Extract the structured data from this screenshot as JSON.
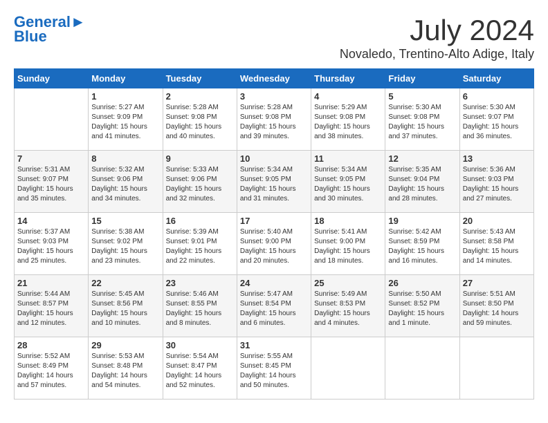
{
  "header": {
    "logo_line1": "General",
    "logo_line2": "Blue",
    "month": "July 2024",
    "location": "Novaledo, Trentino-Alto Adige, Italy"
  },
  "weekdays": [
    "Sunday",
    "Monday",
    "Tuesday",
    "Wednesday",
    "Thursday",
    "Friday",
    "Saturday"
  ],
  "weeks": [
    [
      {
        "day": "",
        "info": ""
      },
      {
        "day": "1",
        "info": "Sunrise: 5:27 AM\nSunset: 9:09 PM\nDaylight: 15 hours\nand 41 minutes."
      },
      {
        "day": "2",
        "info": "Sunrise: 5:28 AM\nSunset: 9:08 PM\nDaylight: 15 hours\nand 40 minutes."
      },
      {
        "day": "3",
        "info": "Sunrise: 5:28 AM\nSunset: 9:08 PM\nDaylight: 15 hours\nand 39 minutes."
      },
      {
        "day": "4",
        "info": "Sunrise: 5:29 AM\nSunset: 9:08 PM\nDaylight: 15 hours\nand 38 minutes."
      },
      {
        "day": "5",
        "info": "Sunrise: 5:30 AM\nSunset: 9:08 PM\nDaylight: 15 hours\nand 37 minutes."
      },
      {
        "day": "6",
        "info": "Sunrise: 5:30 AM\nSunset: 9:07 PM\nDaylight: 15 hours\nand 36 minutes."
      }
    ],
    [
      {
        "day": "7",
        "info": "Sunrise: 5:31 AM\nSunset: 9:07 PM\nDaylight: 15 hours\nand 35 minutes."
      },
      {
        "day": "8",
        "info": "Sunrise: 5:32 AM\nSunset: 9:06 PM\nDaylight: 15 hours\nand 34 minutes."
      },
      {
        "day": "9",
        "info": "Sunrise: 5:33 AM\nSunset: 9:06 PM\nDaylight: 15 hours\nand 32 minutes."
      },
      {
        "day": "10",
        "info": "Sunrise: 5:34 AM\nSunset: 9:05 PM\nDaylight: 15 hours\nand 31 minutes."
      },
      {
        "day": "11",
        "info": "Sunrise: 5:34 AM\nSunset: 9:05 PM\nDaylight: 15 hours\nand 30 minutes."
      },
      {
        "day": "12",
        "info": "Sunrise: 5:35 AM\nSunset: 9:04 PM\nDaylight: 15 hours\nand 28 minutes."
      },
      {
        "day": "13",
        "info": "Sunrise: 5:36 AM\nSunset: 9:03 PM\nDaylight: 15 hours\nand 27 minutes."
      }
    ],
    [
      {
        "day": "14",
        "info": "Sunrise: 5:37 AM\nSunset: 9:03 PM\nDaylight: 15 hours\nand 25 minutes."
      },
      {
        "day": "15",
        "info": "Sunrise: 5:38 AM\nSunset: 9:02 PM\nDaylight: 15 hours\nand 23 minutes."
      },
      {
        "day": "16",
        "info": "Sunrise: 5:39 AM\nSunset: 9:01 PM\nDaylight: 15 hours\nand 22 minutes."
      },
      {
        "day": "17",
        "info": "Sunrise: 5:40 AM\nSunset: 9:00 PM\nDaylight: 15 hours\nand 20 minutes."
      },
      {
        "day": "18",
        "info": "Sunrise: 5:41 AM\nSunset: 9:00 PM\nDaylight: 15 hours\nand 18 minutes."
      },
      {
        "day": "19",
        "info": "Sunrise: 5:42 AM\nSunset: 8:59 PM\nDaylight: 15 hours\nand 16 minutes."
      },
      {
        "day": "20",
        "info": "Sunrise: 5:43 AM\nSunset: 8:58 PM\nDaylight: 15 hours\nand 14 minutes."
      }
    ],
    [
      {
        "day": "21",
        "info": "Sunrise: 5:44 AM\nSunset: 8:57 PM\nDaylight: 15 hours\nand 12 minutes."
      },
      {
        "day": "22",
        "info": "Sunrise: 5:45 AM\nSunset: 8:56 PM\nDaylight: 15 hours\nand 10 minutes."
      },
      {
        "day": "23",
        "info": "Sunrise: 5:46 AM\nSunset: 8:55 PM\nDaylight: 15 hours\nand 8 minutes."
      },
      {
        "day": "24",
        "info": "Sunrise: 5:47 AM\nSunset: 8:54 PM\nDaylight: 15 hours\nand 6 minutes."
      },
      {
        "day": "25",
        "info": "Sunrise: 5:49 AM\nSunset: 8:53 PM\nDaylight: 15 hours\nand 4 minutes."
      },
      {
        "day": "26",
        "info": "Sunrise: 5:50 AM\nSunset: 8:52 PM\nDaylight: 15 hours\nand 1 minute."
      },
      {
        "day": "27",
        "info": "Sunrise: 5:51 AM\nSunset: 8:50 PM\nDaylight: 14 hours\nand 59 minutes."
      }
    ],
    [
      {
        "day": "28",
        "info": "Sunrise: 5:52 AM\nSunset: 8:49 PM\nDaylight: 14 hours\nand 57 minutes."
      },
      {
        "day": "29",
        "info": "Sunrise: 5:53 AM\nSunset: 8:48 PM\nDaylight: 14 hours\nand 54 minutes."
      },
      {
        "day": "30",
        "info": "Sunrise: 5:54 AM\nSunset: 8:47 PM\nDaylight: 14 hours\nand 52 minutes."
      },
      {
        "day": "31",
        "info": "Sunrise: 5:55 AM\nSunset: 8:45 PM\nDaylight: 14 hours\nand 50 minutes."
      },
      {
        "day": "",
        "info": ""
      },
      {
        "day": "",
        "info": ""
      },
      {
        "day": "",
        "info": ""
      }
    ]
  ]
}
